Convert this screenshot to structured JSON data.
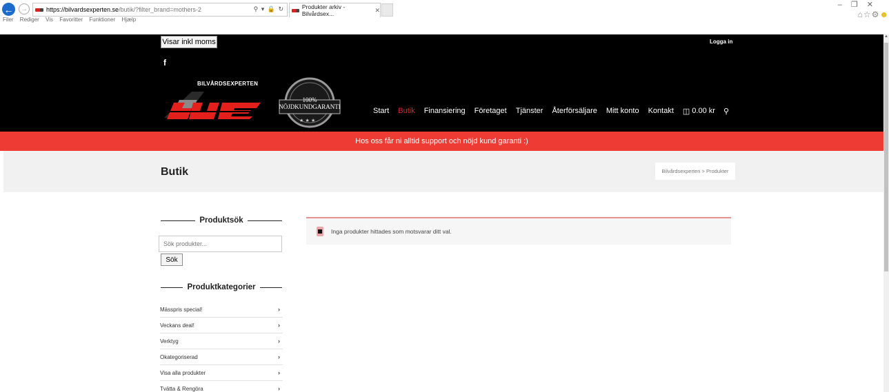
{
  "browser": {
    "url_host": "https://bilvardsexperten.se",
    "url_path": "/butik/?filter_brand=mothers-2",
    "tab_title": "Produkter arkiv - Bilvårdsex...",
    "menu": [
      "Filer",
      "Rediger",
      "Vis",
      "Favoritter",
      "Funktioner",
      "Hjælp"
    ],
    "icons": {
      "back": "back-arrow-icon",
      "forward": "forward-arrow-icon",
      "search": "search-icon",
      "lock": "lock-icon",
      "refresh": "refresh-icon",
      "home": "home-icon",
      "favorites": "star-icon",
      "settings": "gear-icon",
      "feedback": "smiley-icon"
    }
  },
  "header": {
    "moms_button": "Visar inkl moms",
    "login": "Logga in",
    "logo_text": "BILVÅRDSEXPERTEN",
    "badge_percent": "100%",
    "badge_label": "NÖJDKUNDGARANTI",
    "nav": [
      "Start",
      "Butik",
      "Finansiering",
      "Företaget",
      "Tjänster",
      "Återförsäljare",
      "Mitt konto",
      "Kontakt"
    ],
    "active_nav": "Butik",
    "cart_amount": "0.00 kr"
  },
  "promo": "Hos oss får ni alltid support och nöjd kund garanti :)",
  "page": {
    "title": "Butik",
    "breadcrumb": "Bilvårdsexperten > Produkter"
  },
  "sidebar": {
    "search_title": "Produktsök",
    "search_placeholder": "Sök produkter...",
    "search_button": "Sök",
    "categories_title": "Produktkategorier",
    "categories": [
      "Mässpris special!",
      "Veckans deal!",
      "Verktyg",
      "Okategoriserad",
      "Visa alla produkter",
      "Tvätta & Rengöra"
    ]
  },
  "notice": "Inga produkter hittades som motsvarar ditt val.",
  "colors": {
    "accent_red": "#ee3b33",
    "active_nav": "#d62b2b",
    "header_bg": "#000000"
  }
}
